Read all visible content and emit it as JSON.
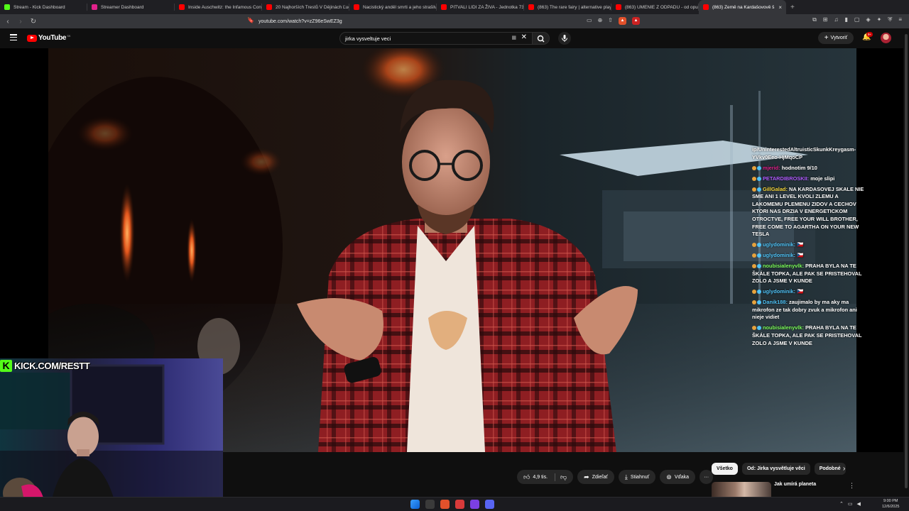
{
  "browser": {
    "tabs": [
      {
        "label": "Stream - Kick Dashboard",
        "color": "#53fc18"
      },
      {
        "label": "Streamer Dashboard",
        "color": "#e0218a"
      },
      {
        "label": "Inside Auschwitz: the Infamous Conc",
        "color": "#ff0000"
      },
      {
        "label": "20 Najhorších Trestů V Dějinách Ľuds",
        "color": "#ff0000"
      },
      {
        "label": "Nacistický anděl smrti a jeho strašliv",
        "color": "#ff0000"
      },
      {
        "label": "PITVALI LIDI ZA ŽIVA - Jednotka 731",
        "color": "#ff0000"
      },
      {
        "label": "(863) The rare fairy | alternative playli",
        "color": "#ff0000"
      },
      {
        "label": "(863) UMENIE Z ODPADU - od opust",
        "color": "#ff0000"
      },
      {
        "label": "(863) Země na Kardašovově š",
        "color": "#ff0000",
        "active": true
      }
    ],
    "new_tab": "+",
    "url": "youtube.com/watch?v=zZ96eSwEZ3g"
  },
  "youtube": {
    "logo_text": "YouTube",
    "region": "SK",
    "search_query": "jirka vysveltuje veci",
    "create_label": "Vytvoriť",
    "notifications_badge": "9+"
  },
  "chat": [
    {
      "user": "",
      "text": "ip/UninterestedAltruisticSkunkKreygasm-YVkv0Eeo-HjMqoCP",
      "color": "#ffffff"
    },
    {
      "user": "mjerid:",
      "text": "hodnotim 9/10",
      "color": "#e0218a"
    },
    {
      "user": "PETARDIBROSKII:",
      "text": "moje slipi",
      "color": "#b05cff"
    },
    {
      "user": "GillGalad:",
      "text": "NA KARDASOVEJ SKALE NIE SME ANI 1 LEVEL KVOLI ZLEMU A LAKOMEMU PLEMENU ZIDOV A CECHOV KTORI NAS DRZIA V ENERGETICKOM OTROCTVE, FREE YOUR WILL BROTHER, FREE COME TO AGARTHA ON YOUR NEW TESLA",
      "color": "#f5d63d"
    },
    {
      "user": "uglydominik:",
      "text": "🇨🇿",
      "color": "#4fc3f7"
    },
    {
      "user": "uglydominik:",
      "text": "🇨🇿",
      "color": "#4fc3f7"
    },
    {
      "user": "noubisialenyvlk:",
      "text": "PRAHA BYLA NA TE ŠKÁLE TOPKA, ALE PAK SE PRISTEHOVAL ZOLO A JSME V KUNDE",
      "color": "#7cff5b"
    },
    {
      "user": "uglydominik:",
      "text": "🇨🇿",
      "color": "#4fc3f7"
    },
    {
      "user": "Danik188:",
      "text": "zaujimalo by ma aky ma mikrofon ze tak dobry zvuk a mikrofon ani nieje vidiet",
      "color": "#4fc3f7"
    },
    {
      "user": "noubisialenyvlk:",
      "text": "PRAHA BYLA NA TE ŠKÁLE TOPKA, ALE PAK SE PRISTEHOVAL ZOLO A JSME V KUNDE",
      "color": "#7cff5b"
    }
  ],
  "overlay": {
    "kick_letter": "K",
    "kick_url": "KICK.COM/RESTT"
  },
  "actions": {
    "likes": "4,9 tis.",
    "share": "Zdieľať",
    "download": "Stiahnuť",
    "thanks": "Vďaka",
    "more": "···"
  },
  "filters": [
    "Všetko",
    "Od: Jirka vysvětluje věci",
    "Podobné"
  ],
  "recommendation": {
    "title": "Jak umírá planeta"
  },
  "taskbar": {
    "time": "9:00 PM",
    "date": "12/6/2025"
  }
}
